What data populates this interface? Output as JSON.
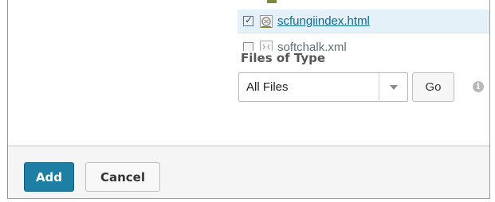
{
  "files": [
    {
      "name": "scfungiindex.html",
      "checked": true,
      "icon": "web-page-icon"
    },
    {
      "name": "softchalk.xml",
      "checked": false,
      "icon": "xml-file-icon"
    }
  ],
  "files_of_type": {
    "label": "Files of Type",
    "selected": "All Files",
    "go_label": "Go",
    "info_icon": "info-icon"
  },
  "footer": {
    "add_label": "Add",
    "cancel_label": "Cancel"
  },
  "colors": {
    "primary": "#1f7ea3",
    "link": "#0b6a96",
    "selected_row": "#e5f1f9"
  }
}
